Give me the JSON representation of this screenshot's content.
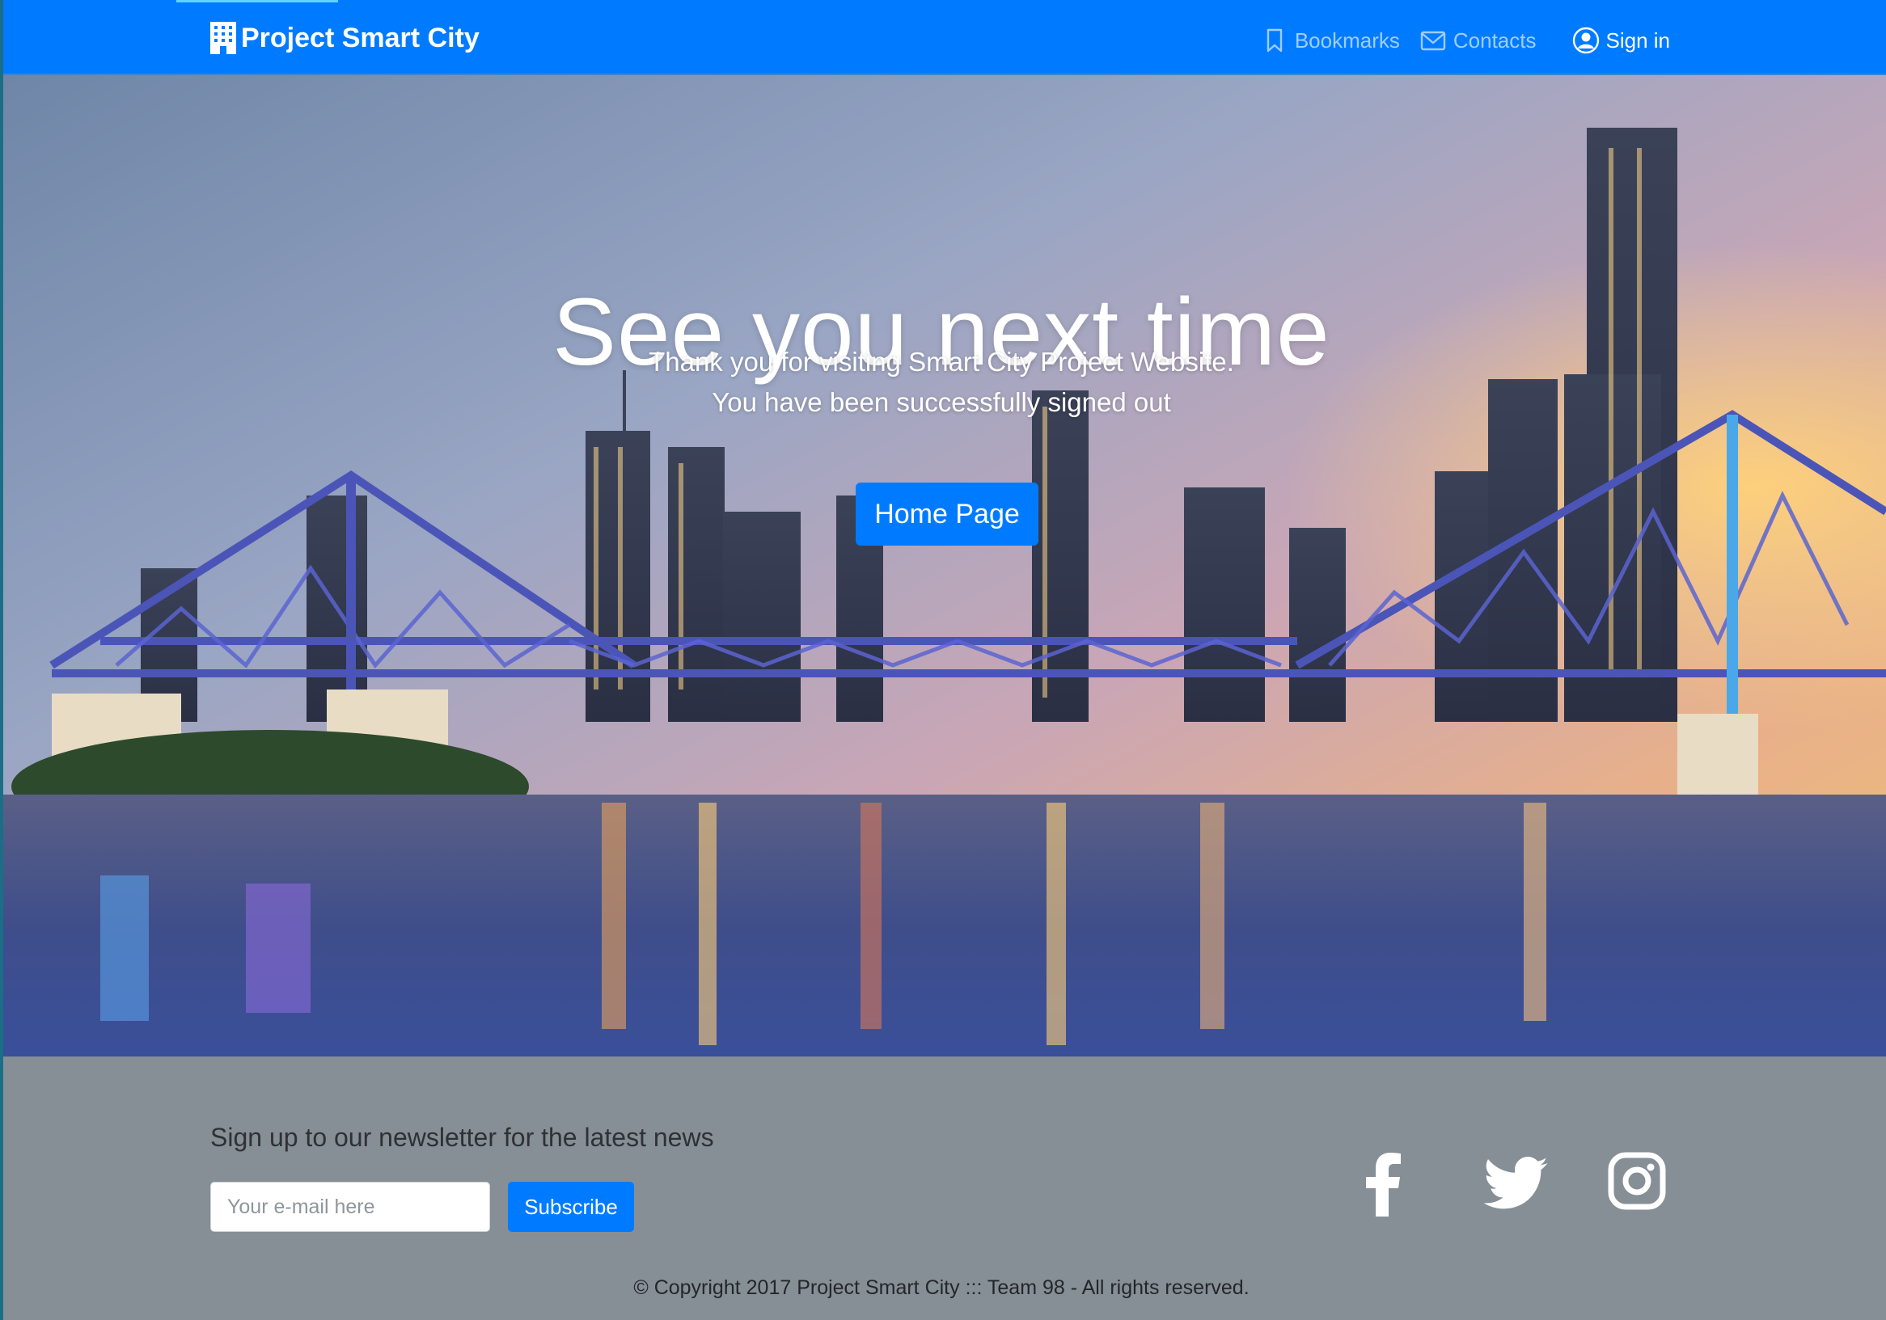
{
  "navbar": {
    "brand": "Project Smart City",
    "links": {
      "bookmarks": "Bookmarks",
      "contacts": "Contacts",
      "signin": "Sign in"
    }
  },
  "hero": {
    "title": "See you next time",
    "subtitle_line1": "Thank you for visiting Smart City Project Website.",
    "subtitle_line2": "You have been successfully signed out",
    "button_label": "Home Page"
  },
  "footer": {
    "newsletter_title": "Sign up to our newsletter for the latest news",
    "email_placeholder": "Your e-mail here",
    "subscribe_label": "Subscribe",
    "social": [
      "facebook-icon",
      "twitter-icon",
      "instagram-icon"
    ],
    "copyright": "© Copyright 2017 Project Smart City ::: Team 98 - All rights reserved."
  },
  "colors": {
    "primary": "#007bff",
    "footer_bg": "#868e96"
  }
}
